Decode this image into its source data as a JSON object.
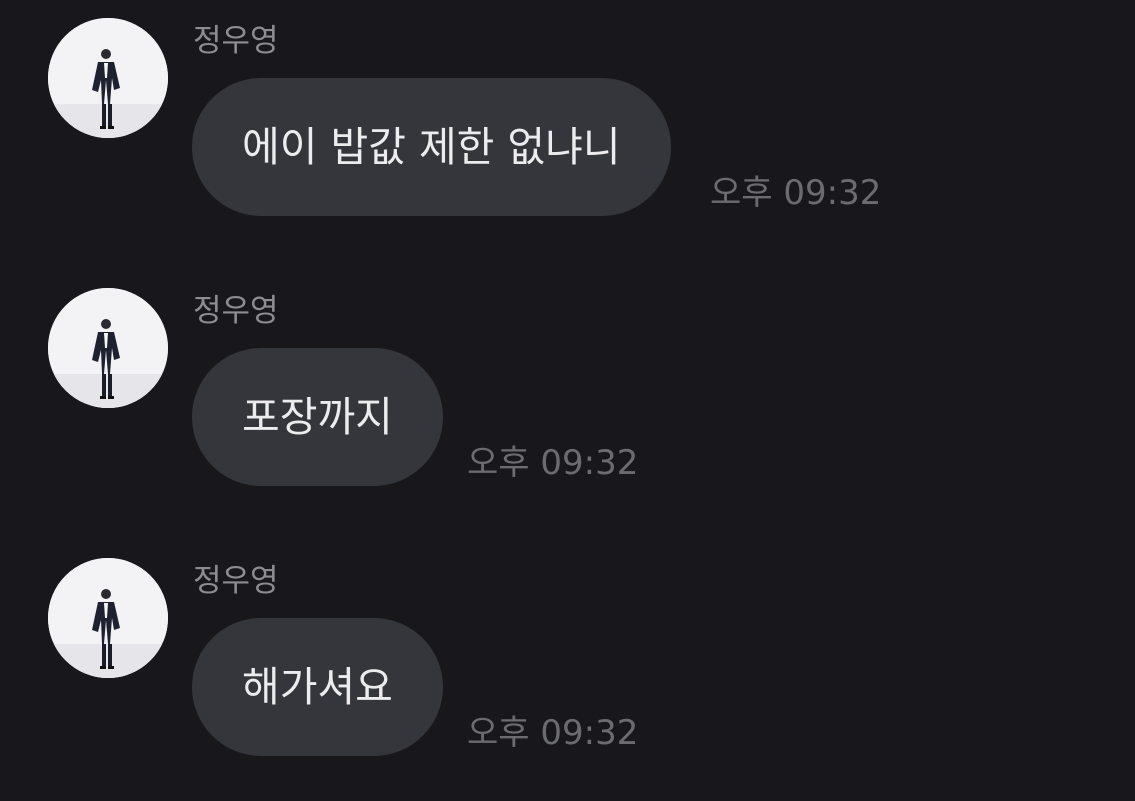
{
  "messages": [
    {
      "sender": "정우영",
      "text": "에이 밥값 제한 없냐니",
      "time": "오후 09:32"
    },
    {
      "sender": "정우영",
      "text": "포장까지",
      "time": "오후 09:32"
    },
    {
      "sender": "정우영",
      "text": "해가셔요",
      "time": "오후 09:32"
    }
  ],
  "avatar_icon": "profile-photo-person-standing",
  "colors": {
    "background": "#18181c",
    "bubble": "#35353c",
    "bubble_text": "#ececef",
    "sender_text": "#8c8c93",
    "time_text": "#6b6b72"
  }
}
